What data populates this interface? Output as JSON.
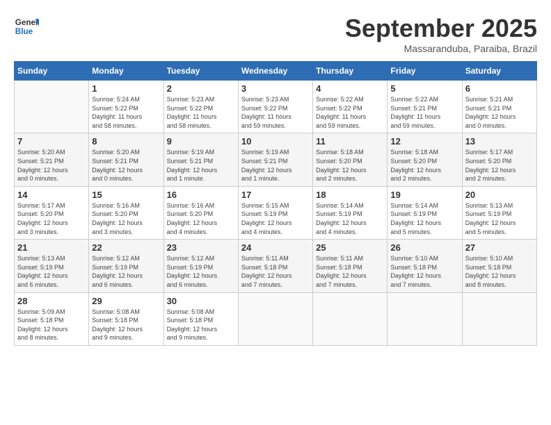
{
  "logo": {
    "line1": "General",
    "line2": "Blue"
  },
  "header": {
    "title": "September 2025",
    "subtitle": "Massaranduba, Paraiba, Brazil"
  },
  "weekdays": [
    "Sunday",
    "Monday",
    "Tuesday",
    "Wednesday",
    "Thursday",
    "Friday",
    "Saturday"
  ],
  "weeks": [
    [
      {
        "day": "",
        "info": ""
      },
      {
        "day": "1",
        "info": "Sunrise: 5:24 AM\nSunset: 5:22 PM\nDaylight: 11 hours\nand 58 minutes."
      },
      {
        "day": "2",
        "info": "Sunrise: 5:23 AM\nSunset: 5:22 PM\nDaylight: 11 hours\nand 58 minutes."
      },
      {
        "day": "3",
        "info": "Sunrise: 5:23 AM\nSunset: 5:22 PM\nDaylight: 11 hours\nand 59 minutes."
      },
      {
        "day": "4",
        "info": "Sunrise: 5:22 AM\nSunset: 5:22 PM\nDaylight: 11 hours\nand 59 minutes."
      },
      {
        "day": "5",
        "info": "Sunrise: 5:22 AM\nSunset: 5:21 PM\nDaylight: 11 hours\nand 59 minutes."
      },
      {
        "day": "6",
        "info": "Sunrise: 5:21 AM\nSunset: 5:21 PM\nDaylight: 12 hours\nand 0 minutes."
      }
    ],
    [
      {
        "day": "7",
        "info": "Sunrise: 5:20 AM\nSunset: 5:21 PM\nDaylight: 12 hours\nand 0 minutes."
      },
      {
        "day": "8",
        "info": "Sunrise: 5:20 AM\nSunset: 5:21 PM\nDaylight: 12 hours\nand 0 minutes."
      },
      {
        "day": "9",
        "info": "Sunrise: 5:19 AM\nSunset: 5:21 PM\nDaylight: 12 hours\nand 1 minute."
      },
      {
        "day": "10",
        "info": "Sunrise: 5:19 AM\nSunset: 5:21 PM\nDaylight: 12 hours\nand 1 minute."
      },
      {
        "day": "11",
        "info": "Sunrise: 5:18 AM\nSunset: 5:20 PM\nDaylight: 12 hours\nand 2 minutes."
      },
      {
        "day": "12",
        "info": "Sunrise: 5:18 AM\nSunset: 5:20 PM\nDaylight: 12 hours\nand 2 minutes."
      },
      {
        "day": "13",
        "info": "Sunrise: 5:17 AM\nSunset: 5:20 PM\nDaylight: 12 hours\nand 2 minutes."
      }
    ],
    [
      {
        "day": "14",
        "info": "Sunrise: 5:17 AM\nSunset: 5:20 PM\nDaylight: 12 hours\nand 3 minutes."
      },
      {
        "day": "15",
        "info": "Sunrise: 5:16 AM\nSunset: 5:20 PM\nDaylight: 12 hours\nand 3 minutes."
      },
      {
        "day": "16",
        "info": "Sunrise: 5:16 AM\nSunset: 5:20 PM\nDaylight: 12 hours\nand 4 minutes."
      },
      {
        "day": "17",
        "info": "Sunrise: 5:15 AM\nSunset: 5:19 PM\nDaylight: 12 hours\nand 4 minutes."
      },
      {
        "day": "18",
        "info": "Sunrise: 5:14 AM\nSunset: 5:19 PM\nDaylight: 12 hours\nand 4 minutes."
      },
      {
        "day": "19",
        "info": "Sunrise: 5:14 AM\nSunset: 5:19 PM\nDaylight: 12 hours\nand 5 minutes."
      },
      {
        "day": "20",
        "info": "Sunrise: 5:13 AM\nSunset: 5:19 PM\nDaylight: 12 hours\nand 5 minutes."
      }
    ],
    [
      {
        "day": "21",
        "info": "Sunrise: 5:13 AM\nSunset: 5:19 PM\nDaylight: 12 hours\nand 6 minutes."
      },
      {
        "day": "22",
        "info": "Sunrise: 5:12 AM\nSunset: 5:19 PM\nDaylight: 12 hours\nand 6 minutes."
      },
      {
        "day": "23",
        "info": "Sunrise: 5:12 AM\nSunset: 5:19 PM\nDaylight: 12 hours\nand 6 minutes."
      },
      {
        "day": "24",
        "info": "Sunrise: 5:11 AM\nSunset: 5:18 PM\nDaylight: 12 hours\nand 7 minutes."
      },
      {
        "day": "25",
        "info": "Sunrise: 5:11 AM\nSunset: 5:18 PM\nDaylight: 12 hours\nand 7 minutes."
      },
      {
        "day": "26",
        "info": "Sunrise: 5:10 AM\nSunset: 5:18 PM\nDaylight: 12 hours\nand 7 minutes."
      },
      {
        "day": "27",
        "info": "Sunrise: 5:10 AM\nSunset: 5:18 PM\nDaylight: 12 hours\nand 8 minutes."
      }
    ],
    [
      {
        "day": "28",
        "info": "Sunrise: 5:09 AM\nSunset: 5:18 PM\nDaylight: 12 hours\nand 8 minutes."
      },
      {
        "day": "29",
        "info": "Sunrise: 5:08 AM\nSunset: 5:18 PM\nDaylight: 12 hours\nand 9 minutes."
      },
      {
        "day": "30",
        "info": "Sunrise: 5:08 AM\nSunset: 5:18 PM\nDaylight: 12 hours\nand 9 minutes."
      },
      {
        "day": "",
        "info": ""
      },
      {
        "day": "",
        "info": ""
      },
      {
        "day": "",
        "info": ""
      },
      {
        "day": "",
        "info": ""
      }
    ]
  ]
}
